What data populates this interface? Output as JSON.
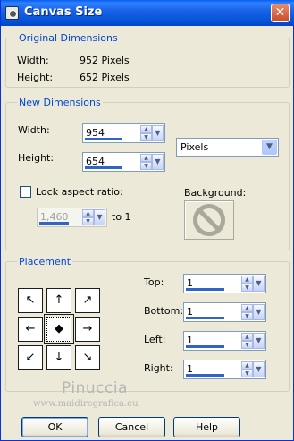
{
  "window": {
    "title": "Canvas Size",
    "close_glyph": "✕"
  },
  "original": {
    "group_label": "Original Dimensions",
    "width_label": "Width:",
    "width_value": "952 Pixels",
    "height_label": "Height:",
    "height_value": "652 Pixels"
  },
  "new_dims": {
    "group_label": "New Dimensions",
    "width_label": "Width:",
    "width_value": "954",
    "width_level": 0.7,
    "height_label": "Height:",
    "height_value": "654",
    "height_level": 0.7,
    "units": "Pixels",
    "lock_label": "Lock aspect ratio:",
    "lock_checked": false,
    "ratio_value": "1,460",
    "ratio_level": 0.6,
    "to_label": "to 1",
    "background_label": "Background:"
  },
  "placement": {
    "group_label": "Placement",
    "anchors": [
      {
        "glyph": "↖"
      },
      {
        "glyph": "↑"
      },
      {
        "glyph": "↗"
      },
      {
        "glyph": "←"
      },
      {
        "glyph": "◆"
      },
      {
        "glyph": "→"
      },
      {
        "glyph": "↙"
      },
      {
        "glyph": "↓"
      },
      {
        "glyph": "↘"
      }
    ],
    "selected_anchor": "center",
    "top_label": "Top:",
    "top_value": "1",
    "bottom_label": "Bottom:",
    "bottom_value": "1",
    "left_label": "Left:",
    "left_value": "1",
    "right_label": "Right:",
    "right_value": "1",
    "offset_level": 0.7
  },
  "watermark": {
    "name": "Pinuccia",
    "url": "www.maidiregrafica.eu"
  },
  "buttons": {
    "ok": "OK",
    "cancel": "Cancel",
    "help": "Help"
  },
  "icons": {
    "app": "canvas-app-icon",
    "close": "close-icon",
    "spin": "spin-arrows-icon",
    "dropdown": "chevron-down-icon",
    "background": "no-symbol-icon"
  },
  "colors": {
    "titlebar": "#0553d8",
    "group_label": "#0046d5",
    "level_bar": "#3164c8",
    "face": "#ece9d8"
  }
}
